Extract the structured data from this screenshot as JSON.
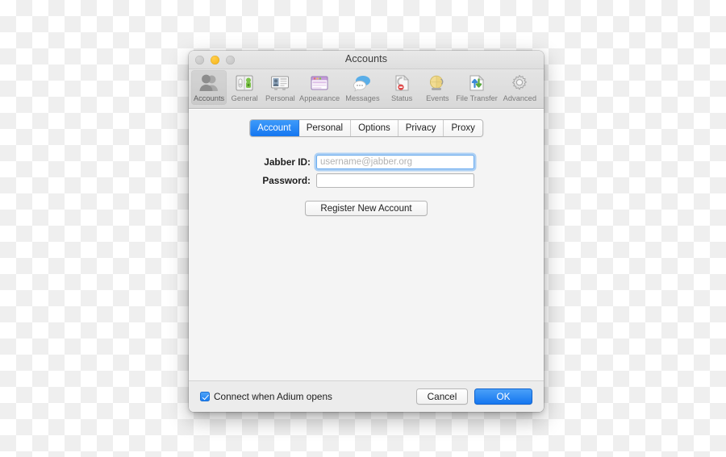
{
  "window": {
    "title": "Accounts",
    "traffic_lights": [
      {
        "name": "close-button",
        "color": "#c8c8c8"
      },
      {
        "name": "minimize-button",
        "color": "#f6b414"
      },
      {
        "name": "zoom-button",
        "color": "#c8c8c8"
      }
    ]
  },
  "toolbar": {
    "items": [
      {
        "label": "Accounts",
        "icon": "accounts-icon",
        "selected": true
      },
      {
        "label": "General",
        "icon": "general-icon",
        "selected": false
      },
      {
        "label": "Personal",
        "icon": "personal-icon",
        "selected": false
      },
      {
        "label": "Appearance",
        "icon": "appearance-icon",
        "selected": false
      },
      {
        "label": "Messages",
        "icon": "messages-icon",
        "selected": false
      },
      {
        "label": "Status",
        "icon": "status-icon",
        "selected": false
      },
      {
        "label": "Events",
        "icon": "events-icon",
        "selected": false
      },
      {
        "label": "File Transfer",
        "icon": "file-transfer-icon",
        "selected": false
      },
      {
        "label": "Advanced",
        "icon": "advanced-icon",
        "selected": false
      }
    ]
  },
  "tabs": [
    {
      "label": "Account",
      "active": true
    },
    {
      "label": "Personal",
      "active": false
    },
    {
      "label": "Options",
      "active": false
    },
    {
      "label": "Privacy",
      "active": false
    },
    {
      "label": "Proxy",
      "active": false
    }
  ],
  "form": {
    "jabber_id": {
      "label": "Jabber ID:",
      "value": "",
      "placeholder": "username@jabber.org",
      "focused": true
    },
    "password": {
      "label": "Password:",
      "value": "",
      "placeholder": "",
      "focused": false
    },
    "register_button": "Register New Account"
  },
  "footer": {
    "connect_checkbox": {
      "label": "Connect when Adium opens",
      "checked": true
    },
    "cancel_label": "Cancel",
    "ok_label": "OK"
  },
  "colors": {
    "accent_blue": "#1476f0",
    "amber": "#f6b414",
    "window_bg": "#ececec",
    "content_bg": "#f4f4f4"
  }
}
